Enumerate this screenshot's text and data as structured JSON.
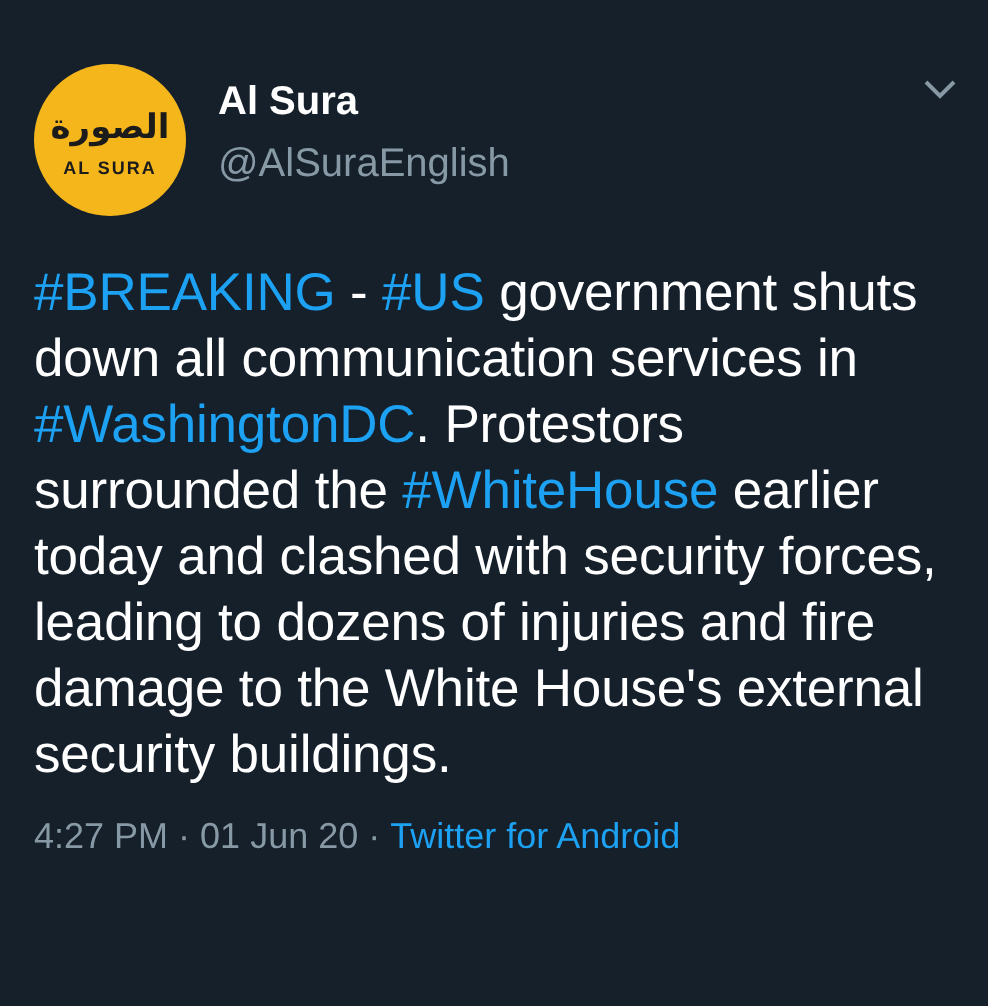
{
  "author": {
    "logo": {
      "arabic": "الصورة",
      "latin": "AL SURA"
    },
    "name": "Al Sura",
    "handle": "@AlSuraEnglish"
  },
  "body": [
    {
      "kind": "hashtag",
      "text": "#BREAKING"
    },
    {
      "kind": "plain",
      "text": " - "
    },
    {
      "kind": "hashtag",
      "text": "#US"
    },
    {
      "kind": "plain",
      "text": " government shuts down all communication services in "
    },
    {
      "kind": "hashtag",
      "text": "#WashingtonDC"
    },
    {
      "kind": "plain",
      "text": ". Protestors surrounded the "
    },
    {
      "kind": "hashtag",
      "text": "#WhiteHouse"
    },
    {
      "kind": "plain",
      "text": " earlier today and clashed with security forces, leading to dozens of injuries and fire damage to the White House's external security buildings."
    }
  ],
  "footer": {
    "time": "4:27 PM",
    "separator": "·",
    "date": "01 Jun 20",
    "source": "Twitter for Android"
  }
}
